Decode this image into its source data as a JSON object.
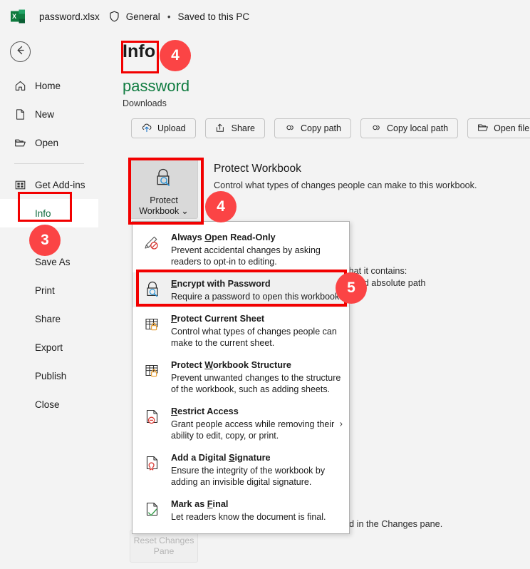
{
  "titlebar": {
    "app_icon": "excel-logo",
    "file_name": "password.xlsx",
    "shield_icon": "shield-icon",
    "sensitivity_label": "General",
    "separator": "•",
    "save_status": "Saved to this PC"
  },
  "sidebar": {
    "back_icon": "back-arrow-icon",
    "items": [
      {
        "label": "Home",
        "icon": "home-icon",
        "selected": false
      },
      {
        "label": "New",
        "icon": "page-icon",
        "selected": false
      },
      {
        "label": "Open",
        "icon": "folder-icon",
        "selected": false
      },
      {
        "label": "Get Add-ins",
        "icon": "addins-icon",
        "selected": false
      },
      {
        "label": "Info",
        "icon": "",
        "selected": true
      },
      {
        "label": "Save As",
        "icon": "",
        "selected": false
      },
      {
        "label": "Print",
        "icon": "",
        "selected": false
      },
      {
        "label": "Share",
        "icon": "",
        "selected": false
      },
      {
        "label": "Export",
        "icon": "",
        "selected": false
      },
      {
        "label": "Publish",
        "icon": "",
        "selected": false
      },
      {
        "label": "Close",
        "icon": "",
        "selected": false
      }
    ]
  },
  "main": {
    "page_title": "Info",
    "document_name": "password",
    "document_location": "Downloads",
    "action_buttons": [
      {
        "label": "Upload",
        "icon": "cloud-upload-icon"
      },
      {
        "label": "Share",
        "icon": "share-icon"
      },
      {
        "label": "Copy path",
        "icon": "link-icon"
      },
      {
        "label": "Copy local path",
        "icon": "link-icon"
      },
      {
        "label": "Open file location",
        "icon": "folder-open-icon"
      }
    ],
    "protect_workbook": {
      "button_label_line1": "Protect",
      "button_label_line2": "Workbook",
      "button_chevron": "⌄",
      "button_icon": "lock-magnifier-icon",
      "heading": "Protect Workbook",
      "description": "Control what types of changes people can make to this workbook."
    },
    "occluded_text": {
      "inspect_line1": "that it contains:",
      "inspect_line2": "e and absolute path",
      "changes_line": "ed in the Changes pane."
    },
    "reset_button": {
      "line1": "Reset Changes",
      "line2": "Pane",
      "disabled": true
    }
  },
  "menu": {
    "items": [
      {
        "title_pre": "Always ",
        "title_accel": "O",
        "title_post": "pen Read-Only",
        "desc_line1": "Prevent accidental changes by asking",
        "desc_line2": "readers to opt-in to editing.",
        "icon": "pencil-no-edit-icon",
        "active": false,
        "has_submenu": false
      },
      {
        "title_pre": "",
        "title_accel": "E",
        "title_post": "ncrypt with Password",
        "desc_line1": "Require a password to open this workbook.",
        "desc_line2": "",
        "icon": "lock-magnifier-icon",
        "active": true,
        "has_submenu": false
      },
      {
        "title_pre": "",
        "title_accel": "P",
        "title_post": "rotect Current Sheet",
        "desc_line1": "Control what types of changes people can",
        "desc_line2": "make to the current sheet.",
        "icon": "sheet-lock-icon",
        "active": false,
        "has_submenu": false
      },
      {
        "title_pre": "Protect ",
        "title_accel": "W",
        "title_post": "orkbook Structure",
        "desc_line1": "Prevent unwanted changes to the structure",
        "desc_line2": "of the workbook, such as adding sheets.",
        "icon": "sheet-lock-icon",
        "active": false,
        "has_submenu": false
      },
      {
        "title_pre": "",
        "title_accel": "R",
        "title_post": "estrict Access",
        "desc_line1": "Grant people access while removing their",
        "desc_line2": "ability to edit, copy, or print.",
        "icon": "document-restrict-icon",
        "active": false,
        "has_submenu": true,
        "submenu_chevron": "›"
      },
      {
        "title_pre": "Add a Digital ",
        "title_accel": "S",
        "title_post": "ignature",
        "desc_line1": "Ensure the integrity of the workbook by",
        "desc_line2": "adding an invisible digital signature.",
        "icon": "document-signature-icon",
        "active": false,
        "has_submenu": false
      },
      {
        "title_pre": "Mark as ",
        "title_accel": "F",
        "title_post": "inal",
        "desc_line1": "Let readers know the document is final.",
        "desc_line2": "",
        "icon": "document-check-icon",
        "active": false,
        "has_submenu": false
      }
    ]
  },
  "annotations": {
    "badges": [
      {
        "number": "3",
        "target": "sidebar-info"
      },
      {
        "number": "4",
        "target": "page-title-info"
      },
      {
        "number": "4",
        "target": "protect-workbook-button"
      },
      {
        "number": "5",
        "target": "encrypt-with-password"
      }
    ],
    "highlight_color": "#f20000",
    "badge_color": "#fb4445"
  }
}
